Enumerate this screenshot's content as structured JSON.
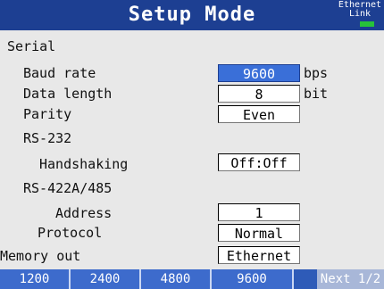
{
  "header": {
    "title": "Setup Mode",
    "ethernet_line1": "Ethernet",
    "ethernet_line2": "Link",
    "link_color": "#27c23a",
    "bar_color": "#1d3f92"
  },
  "settings": {
    "serial_label": "Serial",
    "baud_rate": {
      "label": "Baud rate",
      "value": "9600",
      "unit": "bps",
      "selected": true
    },
    "data_length": {
      "label": "Data length",
      "value": "8",
      "unit": "bit"
    },
    "parity": {
      "label": "Parity",
      "value": "Even"
    },
    "rs232_label": "RS-232",
    "handshaking": {
      "label": "Handshaking",
      "value": "Off:Off"
    },
    "rs422_label": "RS-422A/485",
    "address": {
      "label": "Address",
      "value": "1"
    },
    "protocol": {
      "label": "Protocol",
      "value": "Normal"
    },
    "memory_out": {
      "label": "Memory out",
      "value": "Ethernet"
    }
  },
  "softkeys": {
    "k1": "1200",
    "k2": "2400",
    "k3": "4800",
    "k4": "9600",
    "next": "Next 1/2"
  }
}
